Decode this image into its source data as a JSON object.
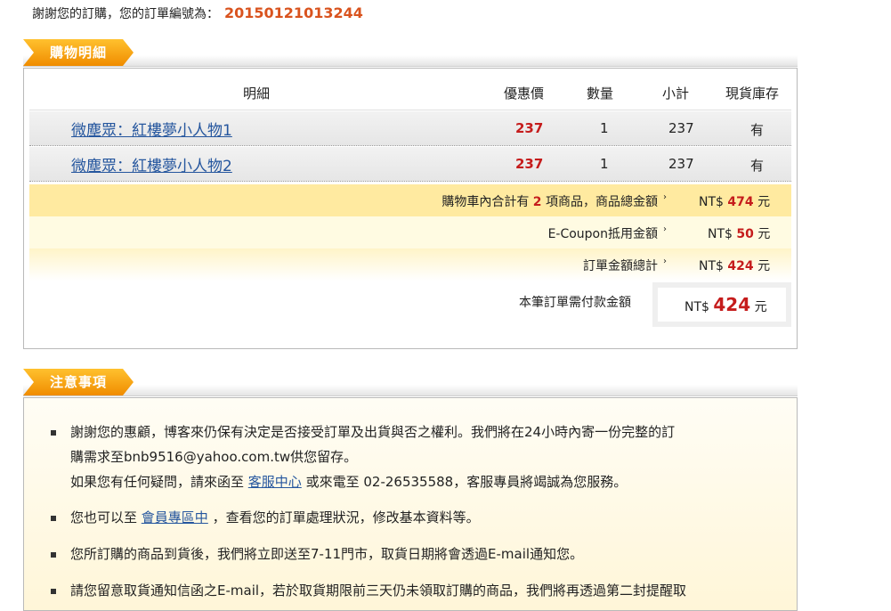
{
  "thanks": {
    "text": "謝謝您的訂購，您的訂單編號為：",
    "order_no": "20150121013244"
  },
  "cart": {
    "section_title": "購物明細",
    "headers": {
      "detail": "明細",
      "price": "優惠價",
      "qty": "數量",
      "subtotal": "小計",
      "stock": "現貨庫存"
    },
    "items": [
      {
        "name": "微塵眾：紅樓夢小人物1",
        "price": "237",
        "qty": "1",
        "subtotal": "237",
        "stock": "有"
      },
      {
        "name": "微塵眾：紅樓夢小人物2",
        "price": "237",
        "qty": "1",
        "subtotal": "237",
        "stock": "有"
      }
    ],
    "total_row": {
      "prefix": "購物車內合計有",
      "count": "2",
      "suffix": "項商品，商品總金額",
      "currency": "NT$",
      "amount": "474",
      "unit": "元"
    },
    "coupon_row": {
      "label": "E-Coupon抵用金額",
      "currency": "NT$",
      "amount": "50",
      "unit": "元"
    },
    "order_total_row": {
      "label": "訂單金額總計",
      "currency": "NT$",
      "amount": "424",
      "unit": "元"
    },
    "pay_row": {
      "label": "本筆訂單需付款金額",
      "currency": "NT$",
      "amount": "424",
      "unit": "元"
    },
    "arrow": "›"
  },
  "notes": {
    "section_title": "注意事項",
    "n1_line1": "謝謝您的惠顧，博客來仍保有決定是否接受訂單及出貨與否之權利。我們將在24小時內寄一份完整的訂",
    "n1_line2": "購需求至bnb9516@yahoo.com.tw供您留存。",
    "n1_line3_a": "如果您有任何疑問，請來函至",
    "n1_link": "客服中心",
    "n1_line3_b": "或來電至 02-26535588，客服專員將竭誠為您服務。",
    "n2_a": "您也可以至",
    "n2_link": "會員專區中",
    "n2_b": "，查看您的訂單處理狀況，修改基本資料等。",
    "n3": "您所訂購的商品到貨後，我們將立即送至7-11門市，取貨日期將會透過E-mail通知您。",
    "n4": "請您留意取貨通知信函之E-mail，若於取貨期限前三天仍未領取訂購的商品，我們將再透過第二封提醒取"
  }
}
